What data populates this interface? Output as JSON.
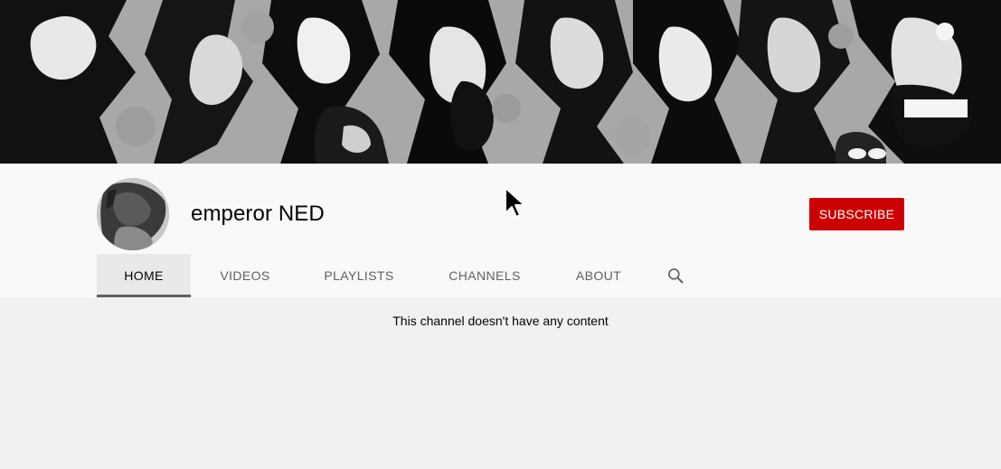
{
  "channel": {
    "name": "emperor NED",
    "subscribe_label": "SUBSCRIBE"
  },
  "tabs": [
    {
      "label": "HOME",
      "active": true
    },
    {
      "label": "VIDEOS",
      "active": false
    },
    {
      "label": "PLAYLISTS",
      "active": false
    },
    {
      "label": "CHANNELS",
      "active": false
    },
    {
      "label": "ABOUT",
      "active": false
    }
  ],
  "search_icon": "search-icon",
  "content": {
    "empty_message": "This channel doesn't have any content"
  },
  "colors": {
    "subscribe_bg": "#cc0000",
    "header_bg": "#f9f9f9",
    "page_bg": "#f1f1f1",
    "active_tab_indicator": "#606060"
  }
}
